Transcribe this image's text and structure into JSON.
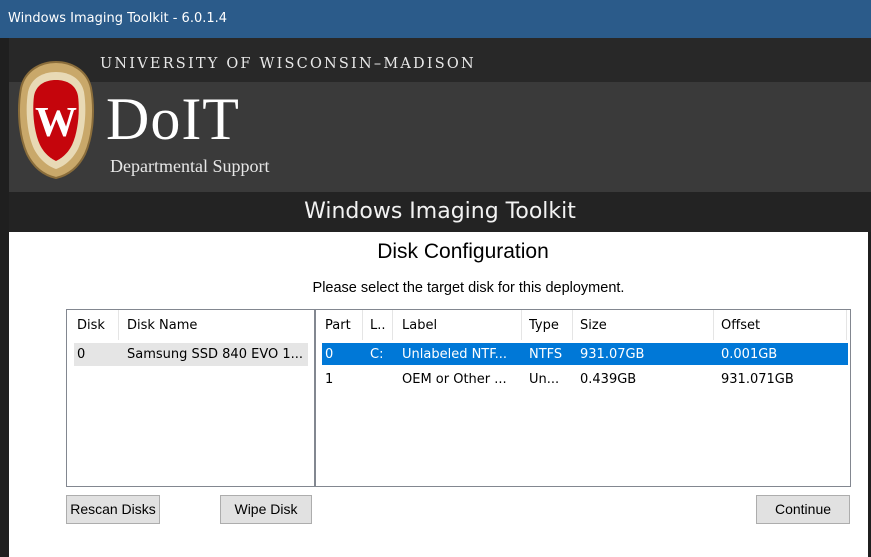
{
  "window": {
    "title": "Windows Imaging Toolkit - 6.0.1.4"
  },
  "banner": {
    "university": "UNIVERSITY OF WISCONSIN–MADISON",
    "logo_text": "DoIT",
    "department": "Departmental Support",
    "app_title": "Windows Imaging Toolkit",
    "crest_letter": "W"
  },
  "page": {
    "heading": "Disk Configuration",
    "instructions": "Please select the target disk for this deployment."
  },
  "disks": {
    "columns": [
      "Disk",
      "Disk Name"
    ],
    "rows": [
      {
        "disk": "0",
        "name": "Samsung SSD 840 EVO 1...",
        "selected": true
      }
    ]
  },
  "partitions": {
    "columns": [
      "Part",
      "L..",
      "Label",
      "Type",
      "Size",
      "Offset"
    ],
    "rows": [
      {
        "part": "0",
        "letter": "C:",
        "label": "Unlabeled NTF...",
        "type": "NTFS",
        "size": "931.07GB",
        "offset": "0.001GB",
        "selected": true
      },
      {
        "part": "1",
        "letter": "",
        "label": "OEM or Other ...",
        "type": "Un...",
        "size": "0.439GB",
        "offset": "931.071GB",
        "selected": false
      }
    ]
  },
  "buttons": {
    "rescan": "Rescan Disks",
    "wipe": "Wipe Disk",
    "continue": "Continue"
  },
  "colors": {
    "titlebar": "#2b5b8a",
    "selection": "#0078d7",
    "crest_red": "#c5050c",
    "crest_gold": "#c9a86a"
  }
}
